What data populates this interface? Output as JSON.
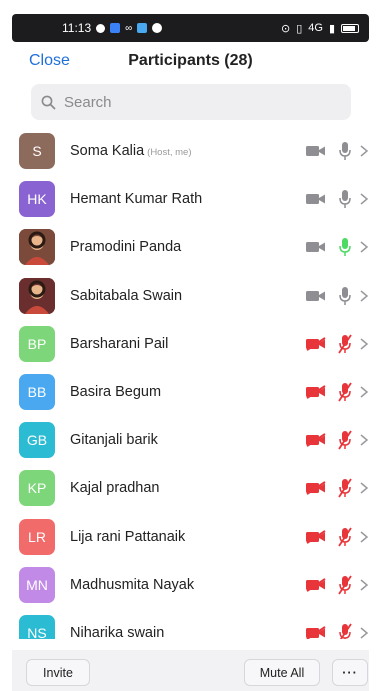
{
  "status_bar": {
    "time": "11:13",
    "signal_text": "4G"
  },
  "header": {
    "close_label": "Close",
    "title": "Participants (28)"
  },
  "search": {
    "placeholder": "Search"
  },
  "participants": [
    {
      "initials": "S",
      "name": "Soma Kalia",
      "note": "(Host, me)",
      "avatar_color": "#8d6b5c",
      "photo": false,
      "video": "off",
      "audio": "off"
    },
    {
      "initials": "HK",
      "name": "Hemant Kumar Rath",
      "note": "",
      "avatar_color": "#8a63d2",
      "photo": false,
      "video": "off",
      "audio": "off"
    },
    {
      "initials": "",
      "name": "Pramodini Panda",
      "note": "",
      "avatar_color": "#7b4a3a",
      "photo": true,
      "video": "off",
      "audio": "on"
    },
    {
      "initials": "",
      "name": "Sabitabala Swain",
      "note": "",
      "avatar_color": "#6b2e2e",
      "photo": true,
      "video": "off",
      "audio": "off"
    },
    {
      "initials": "BP",
      "name": "Barsharani Pail",
      "note": "",
      "avatar_color": "#7ed67a",
      "photo": false,
      "video": "muted",
      "audio": "muted"
    },
    {
      "initials": "BB",
      "name": "Basira Begum",
      "note": "",
      "avatar_color": "#4aa8f0",
      "photo": false,
      "video": "muted",
      "audio": "muted"
    },
    {
      "initials": "GB",
      "name": "Gitanjali barik",
      "note": "",
      "avatar_color": "#2bbcd4",
      "photo": false,
      "video": "muted",
      "audio": "muted"
    },
    {
      "initials": "KP",
      "name": "Kajal pradhan",
      "note": "",
      "avatar_color": "#7ed67a",
      "photo": false,
      "video": "muted",
      "audio": "muted"
    },
    {
      "initials": "LR",
      "name": "Lija rani Pattanaik",
      "note": "",
      "avatar_color": "#f26b6b",
      "photo": false,
      "video": "muted",
      "audio": "muted"
    },
    {
      "initials": "MN",
      "name": "Madhusmita Nayak",
      "note": "",
      "avatar_color": "#c08ae6",
      "photo": false,
      "video": "muted",
      "audio": "muted"
    },
    {
      "initials": "NS",
      "name": "Niharika swain",
      "note": "",
      "avatar_color": "#2bbcd4",
      "photo": false,
      "video": "muted",
      "audio": "muted"
    }
  ],
  "colors": {
    "accent": "#1e6fd9",
    "icon_gray": "#8e8e93",
    "muted_red": "#e8353a",
    "mic_active_green": "#4cd964"
  },
  "bottom_bar": {
    "invite_label": "Invite",
    "mute_all_label": "Mute All",
    "more_label": "···"
  }
}
